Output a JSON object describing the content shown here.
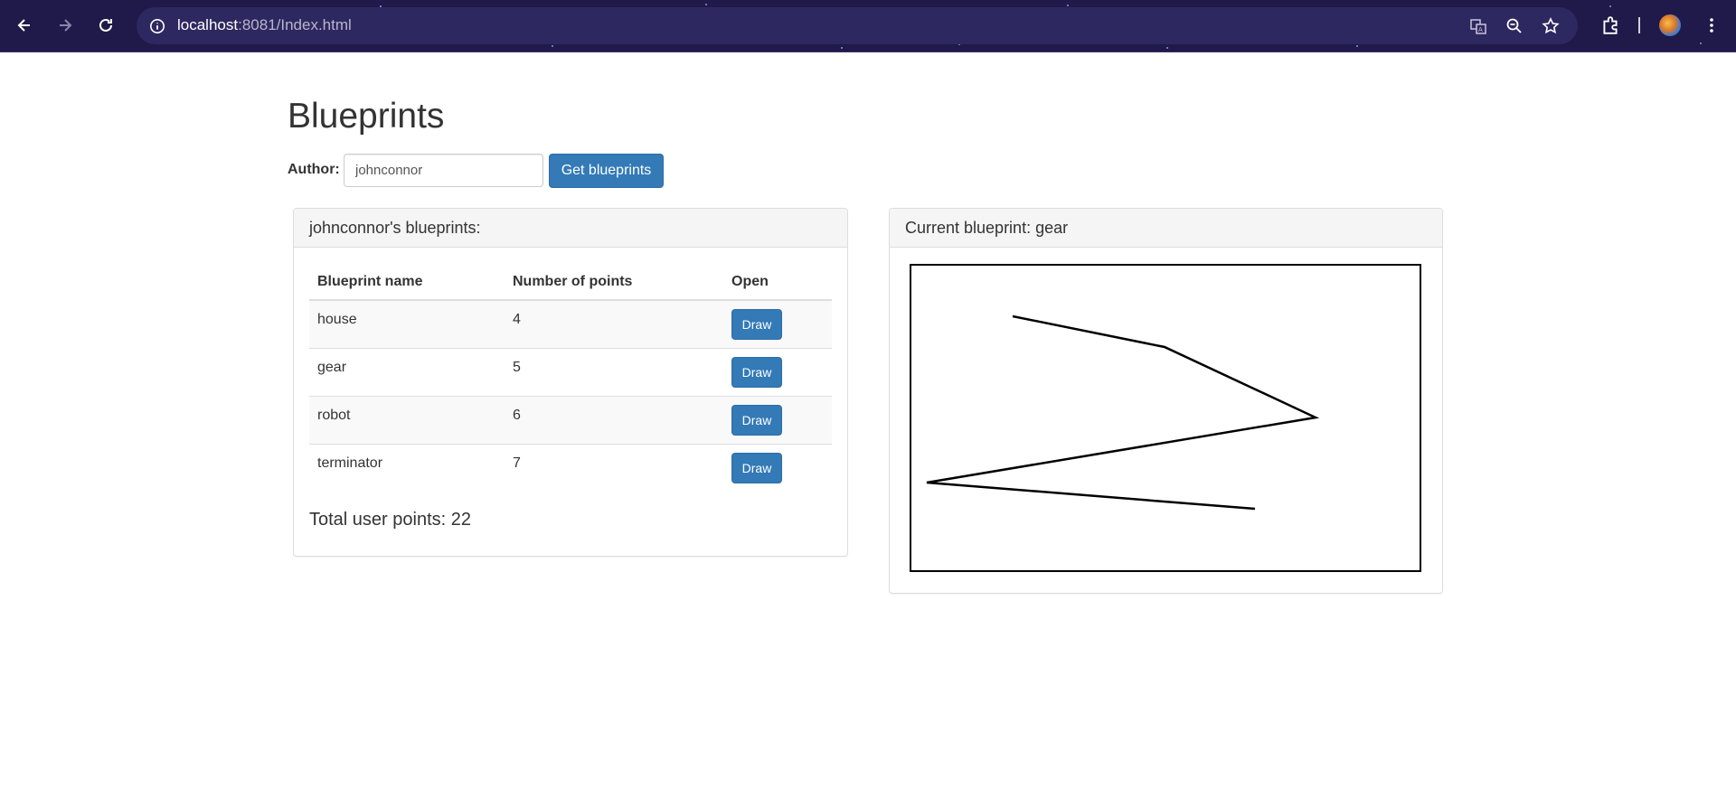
{
  "browser": {
    "url_host": "localhost",
    "url_rest": ":8081/Index.html"
  },
  "page": {
    "title": "Blueprints",
    "author_label": "Author:",
    "author_value": "johnconnor",
    "get_button": "Get blueprints"
  },
  "list_panel": {
    "heading": "johnconnor's blueprints:",
    "columns": [
      "Blueprint name",
      "Number of points",
      "Open"
    ],
    "rows": [
      {
        "name": "house",
        "points": "4",
        "action": "Draw"
      },
      {
        "name": "gear",
        "points": "5",
        "action": "Draw"
      },
      {
        "name": "robot",
        "points": "6",
        "action": "Draw"
      },
      {
        "name": "terminator",
        "points": "7",
        "action": "Draw"
      }
    ],
    "total": "Total user points: 22"
  },
  "current_panel": {
    "heading": "Current blueprint: gear"
  },
  "colors": {
    "chrome_bg": "#1f1a4a",
    "primary": "#337ab7"
  }
}
